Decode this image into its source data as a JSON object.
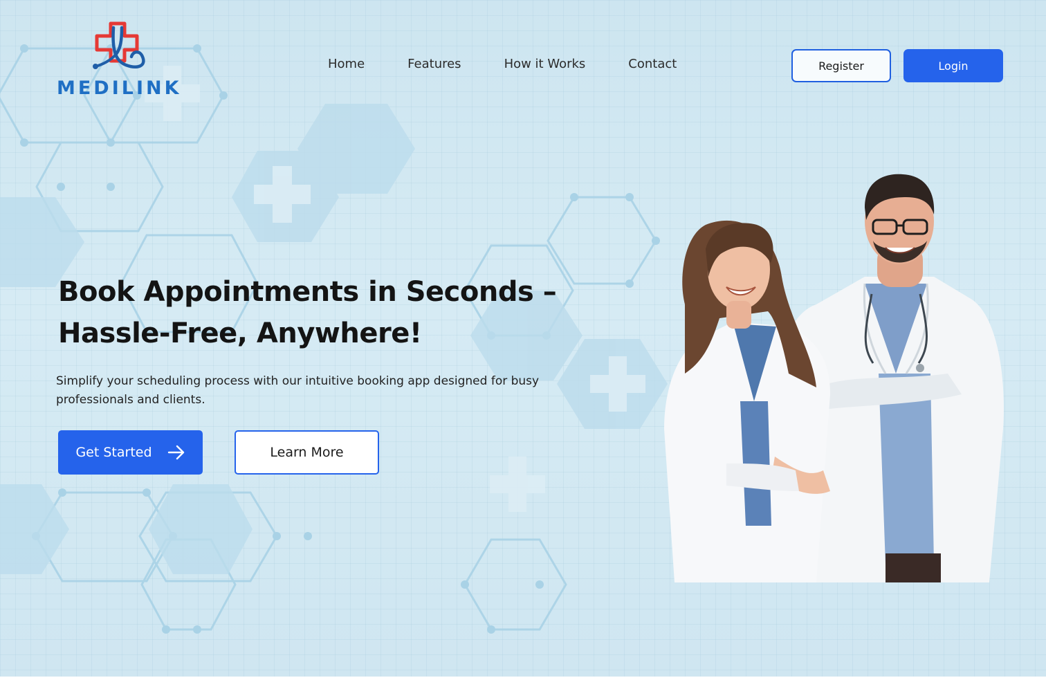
{
  "brand": {
    "name": "MEDILINK",
    "primary_color": "#1f6fc4",
    "cross_color": "#e53935",
    "accent_color": "#2563eb"
  },
  "nav": {
    "links": [
      "Home",
      "Features",
      "How it Works",
      "Contact"
    ],
    "register_label": "Register",
    "login_label": "Login"
  },
  "hero": {
    "title_line1": "Book Appointments in Seconds –",
    "title_line2": "Hassle-Free, Anywhere!",
    "subtitle": "Simplify your scheduling process with our intuitive booking app designed for busy professionals and clients.",
    "primary_cta": "Get Started",
    "secondary_cta": "Learn More"
  },
  "icons": {
    "logo": "stethoscope-cross-icon",
    "cta_arrow": "arrow-right-icon"
  }
}
